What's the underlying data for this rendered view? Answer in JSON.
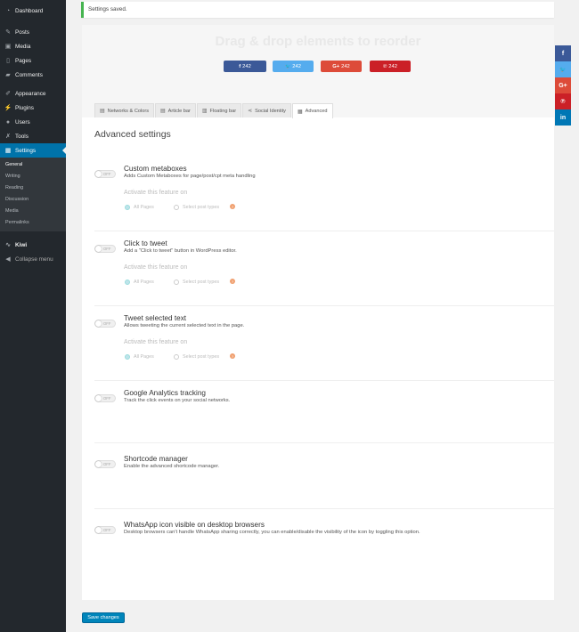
{
  "sidebar": {
    "items": [
      {
        "label": "Dashboard",
        "icon": "dashboard-icon"
      },
      {
        "label": "Posts",
        "icon": "pin-icon"
      },
      {
        "label": "Media",
        "icon": "media-icon"
      },
      {
        "label": "Pages",
        "icon": "page-icon"
      },
      {
        "label": "Comments",
        "icon": "comment-icon"
      },
      {
        "label": "Appearance",
        "icon": "paintbrush-icon"
      },
      {
        "label": "Plugins",
        "icon": "plugin-icon"
      },
      {
        "label": "Users",
        "icon": "users-icon"
      },
      {
        "label": "Tools",
        "icon": "wrench-icon"
      },
      {
        "label": "Settings",
        "icon": "settings-icon"
      }
    ],
    "submenu": [
      "General",
      "Writing",
      "Reading",
      "Discussion",
      "Media",
      "Permalinks"
    ],
    "kiwi": "Kiwi",
    "collapse": "Collapse menu"
  },
  "notice": "Settings saved.",
  "preview": {
    "title": "Drag & drop elements to reorder",
    "buttons": [
      {
        "icon": "f",
        "count": "242",
        "color": "#3b5998"
      },
      {
        "icon": "🐦",
        "count": "242",
        "color": "#55acee"
      },
      {
        "icon": "G+",
        "count": "242",
        "color": "#dd4b39"
      },
      {
        "icon": "℗",
        "count": "242",
        "color": "#cb2027"
      }
    ]
  },
  "tabs": [
    {
      "label": "Networks & Colors",
      "icon": "▤"
    },
    {
      "label": "Article bar",
      "icon": "▤"
    },
    {
      "label": "Floating bar",
      "icon": "▥"
    },
    {
      "label": "Social Identity",
      "icon": "⋖"
    },
    {
      "label": "Advanced",
      "icon": "▦"
    }
  ],
  "heading": "Advanced settings",
  "toggle_off": "OFF",
  "activate_label": "Activate this feature on",
  "radio_all": "All Pages",
  "radio_select": "Select post types",
  "features": [
    {
      "title": "Custom metaboxes",
      "desc": "Adds Custom Metaboxes for page/post/cpt meta handling"
    },
    {
      "title": "Click to tweet",
      "desc": "Add a \"Click to tweet\" button in WordPress editor."
    },
    {
      "title": "Tweet selected text",
      "desc": "Allows tweeting the current selected text in the page."
    },
    {
      "title": "Google Analytics tracking",
      "desc": "Track the click events on your social networks."
    },
    {
      "title": "Shortcode manager",
      "desc": "Enable the advanced shortcode manager."
    },
    {
      "title": "WhatsApp icon visible on desktop browsers",
      "desc": "Desktop browsers can't handle WhatsApp sharing correctly, you can enable/disable the visibility of the icon by toggling this option."
    }
  ],
  "floating_bar": [
    {
      "icon": "f",
      "color": "#3b5998"
    },
    {
      "icon": "🐦",
      "color": "#55acee"
    },
    {
      "icon": "G+",
      "color": "#dd4b39"
    },
    {
      "icon": "℗",
      "color": "#cb2027"
    },
    {
      "icon": "in",
      "color": "#0077b5"
    }
  ],
  "save_label": "Save changes"
}
